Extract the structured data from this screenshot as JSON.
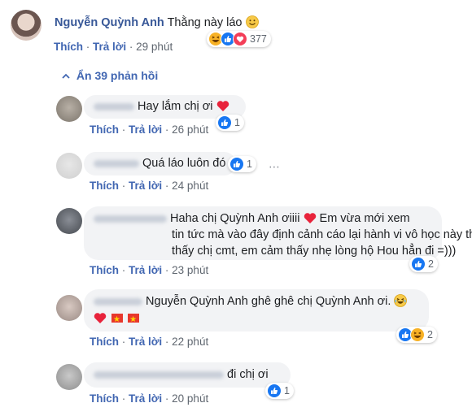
{
  "main_comment": {
    "author": "Nguyễn Quỳnh Anh",
    "text": "Thằng này láo",
    "like_label": "Thích",
    "reply_label": "Trả lời",
    "time": "29 phút",
    "reaction_count": "377"
  },
  "hide_replies_label": "Ẩn 39 phản hồi",
  "replies": [
    {
      "text": "Hay lắm chị ơi",
      "like_label": "Thích",
      "reply_label": "Trả lời",
      "time": "26 phút",
      "reaction_count": "1"
    },
    {
      "text": "Quá láo luôn đó chị",
      "like_label": "Thích",
      "reply_label": "Trả lời",
      "time": "24 phút",
      "reaction_count": "1"
    },
    {
      "text_line1": "Haha chị Quỳnh Anh ơiiii",
      "text_line1b": "Em vừa mới xem",
      "text_line2": "tin tức mà vào đây định cảnh cáo lại hành vi vô học này thì",
      "text_line3": "thấy chị cmt, em cảm thấy nhẹ lòng hộ Hou hẳn đi =)))",
      "like_label": "Thích",
      "reply_label": "Trả lời",
      "time": "23 phút",
      "reaction_count": "2"
    },
    {
      "text": "Nguyễn Quỳnh Anh ghê ghê chị Quỳnh Anh ơi.",
      "like_label": "Thích",
      "reply_label": "Trả lời",
      "time": "22 phút",
      "reaction_count": "2"
    },
    {
      "text": "đi chị ơi",
      "like_label": "Thích",
      "reply_label": "Trả lời",
      "time": "20 phút",
      "reaction_count": "1"
    }
  ],
  "colors": {
    "link": "#4267b2",
    "meta": "#606770",
    "bubble": "#f2f3f5",
    "like": "#1877f2",
    "love": "#f33e58",
    "haha": "#f7b125"
  },
  "icons": [
    "like-icon",
    "haha-icon",
    "love-icon",
    "heart-emoji",
    "smile-emoji",
    "laughing-emoji",
    "vietnam-flag-icon",
    "chevron-up-icon"
  ]
}
